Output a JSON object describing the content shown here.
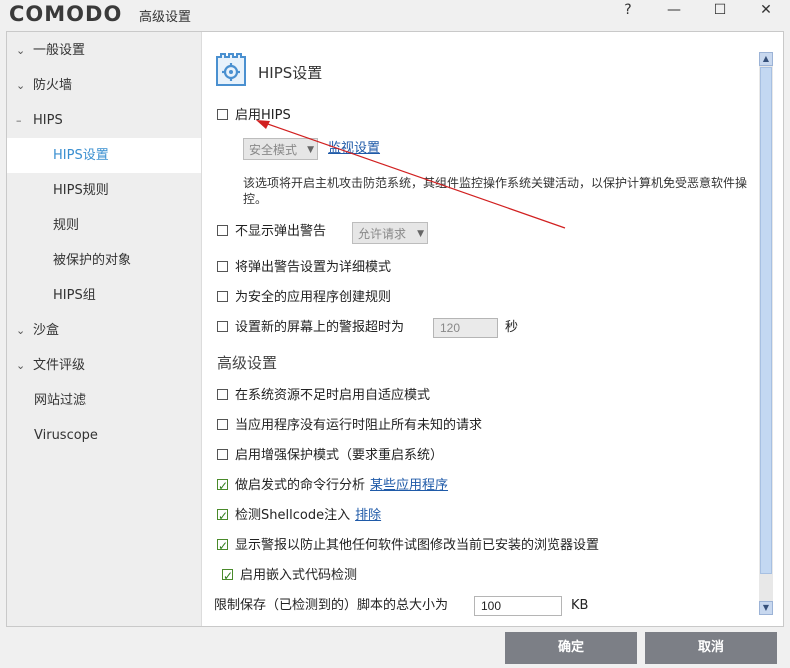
{
  "window": {
    "logo": "COMODO",
    "title": "高级设置",
    "help_icon": "?",
    "minimize_icon": "—",
    "maximize_icon": "☐",
    "close_icon": "✕"
  },
  "sidebar": {
    "items": [
      {
        "label": "一般设置",
        "type": "group",
        "expanded": false
      },
      {
        "label": "防火墙",
        "type": "group",
        "expanded": false
      },
      {
        "label": "HIPS",
        "type": "group",
        "expanded": true
      },
      {
        "label": "HIPS设置",
        "type": "sub",
        "active": true
      },
      {
        "label": "HIPS规则",
        "type": "sub"
      },
      {
        "label": "规则",
        "type": "sub"
      },
      {
        "label": "被保护的对象",
        "type": "sub"
      },
      {
        "label": "HIPS组",
        "type": "sub"
      },
      {
        "label": "沙盒",
        "type": "group",
        "expanded": false
      },
      {
        "label": "文件评级",
        "type": "group",
        "expanded": false
      },
      {
        "label": "网站过滤",
        "type": "plain"
      },
      {
        "label": "Viruscope",
        "type": "plain"
      }
    ],
    "chevron_down": "⌄",
    "collapse_mark": "–"
  },
  "main": {
    "title": "HIPS设置",
    "enable_hips": {
      "label": "启用HIPS",
      "checked": false
    },
    "mode_select": "安全模式",
    "monitor_link": "监视设置",
    "description": "该选项将开启主机攻击防范系统，其组件监控操作系统关键活动，以保护计算机免受恶意软件操控。",
    "no_popup": {
      "label": "不显示弹出警告",
      "checked": false
    },
    "no_popup_select": "允许请求",
    "verbose_popup": {
      "label": "将弹出警告设置为详细模式",
      "checked": false
    },
    "safe_rules": {
      "label": "为安全的应用程序创建规则",
      "checked": false
    },
    "timeout": {
      "label": "设置新的屏幕上的警报超时为",
      "checked": false,
      "value": "120",
      "unit": "秒"
    },
    "advanced_title": "高级设置",
    "adaptive": {
      "label": "在系统资源不足时启用自适应模式",
      "checked": false
    },
    "block_unknown": {
      "label": "当应用程序没有运行时阻止所有未知的请求",
      "checked": false
    },
    "enhanced": {
      "label": "启用增强保护模式（要求重启系统）",
      "checked": false
    },
    "cmdline": {
      "label": "做启发式的命令行分析",
      "checked": true,
      "link": "某些应用程序"
    },
    "shellcode": {
      "label": "检测Shellcode注入",
      "checked": true,
      "link": "排除"
    },
    "browser": {
      "label": "显示警报以防止其他任何软件试图修改当前已安装的浏览器设置",
      "checked": true
    },
    "embedded": {
      "label": "启用嵌入式代码检测",
      "checked": true
    },
    "script_limit": {
      "label": "限制保存（已检测到的）脚本的总大小为",
      "value": "100",
      "unit": "KB"
    }
  },
  "buttons": {
    "ok": "确定",
    "cancel": "取消"
  },
  "colors": {
    "accent": "#3a8fd0",
    "button": "#7c7f86",
    "annotation": "#d12020"
  }
}
